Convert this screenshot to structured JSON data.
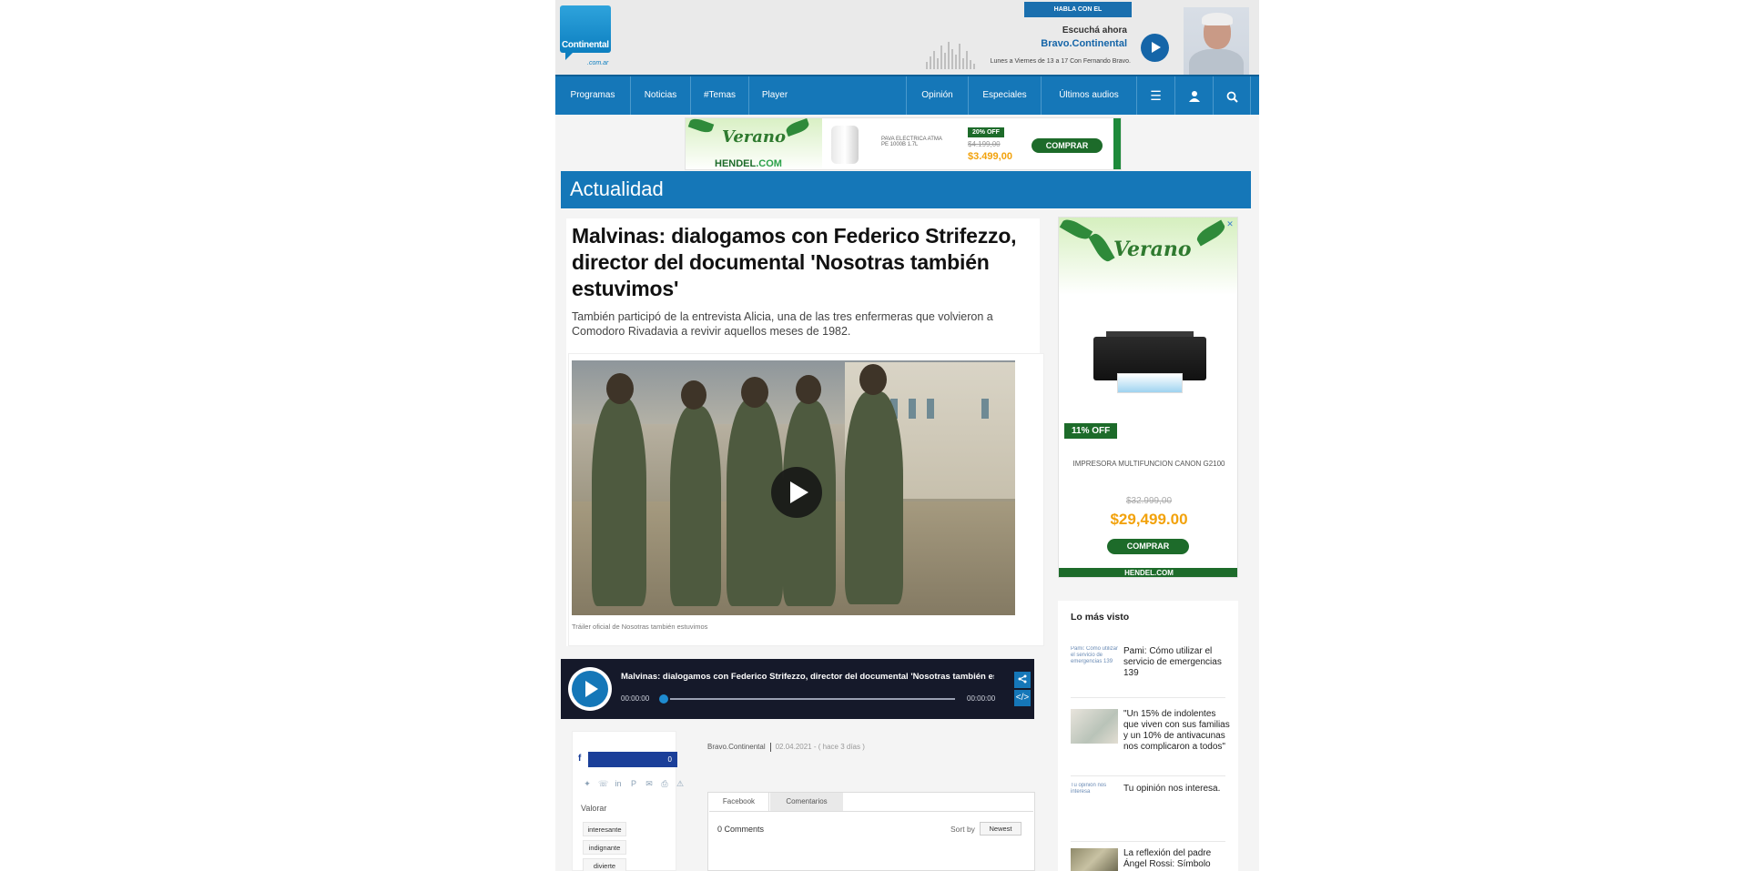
{
  "header": {
    "logo_name": "Continental",
    "logo_domain": ".com.ar",
    "habla_label": "HABLA CON EL",
    "listen_label": "Escuchá ahora",
    "show_name": "Bravo.Continental",
    "schedule": "Lunes a Viernes de 13 a 17 Con Fernando Bravo."
  },
  "nav": {
    "left": [
      "Programas",
      "Noticias",
      "#Temas",
      "Player"
    ],
    "right": [
      "Opinión",
      "Especiales",
      "Últimos audios"
    ],
    "icons": [
      "menu-icon",
      "user-icon",
      "search-icon"
    ]
  },
  "top_ad": {
    "brand_word": "Verano",
    "brand": "HENDEL",
    "brand_suffix": ".COM",
    "description": "PAVA ELECTRICA ATMA PE 1000B 1.7L",
    "discount": "20% OFF",
    "old_price": "$4.199,00",
    "price": "$3.499,00",
    "cta": "COMPRAR"
  },
  "section": {
    "title": "Actualidad"
  },
  "article": {
    "title": "Malvinas: dialogamos con Federico Strifezzo, director del documental 'Nosotras también estuvimos'",
    "subtitle": "También participó de la entrevista Alicia, una de las tres enfermeras que volvieron a Comodoro Rivadavia a revivir aquellos meses de 1982.",
    "video_caption": "Tráiler oficial de Nosotras también estuvimos",
    "author": "Bravo.Continental",
    "date": "02.04.2021 - ( hace 3 días )"
  },
  "audio_player": {
    "title": "Malvinas: dialogamos con Federico Strifezzo, director del documental 'Nosotras también estuvimos'",
    "current_time": "00:00:00",
    "duration": "00:00:00",
    "progress": 0
  },
  "social": {
    "fb_letter": "f",
    "fb_count": "0",
    "icons": [
      "twitter-icon",
      "whatsapp-icon",
      "linkedin-icon",
      "pinterest-icon",
      "email-icon",
      "print-icon",
      "warning-icon"
    ],
    "rate_label": "Valorar",
    "rate_options": [
      "interesante",
      "indignante",
      "divierte"
    ]
  },
  "comments": {
    "tabs": [
      "Facebook",
      "Comentarios"
    ],
    "count": "0 Comments",
    "sort_label": "Sort by",
    "sort_value": "Newest"
  },
  "side_ad": {
    "brand_word": "Verano",
    "discount": "11% OFF",
    "product": "IMPRESORA MULTIFUNCION CANON G2100",
    "old_price": "$32.999,00",
    "price": "$29,499.00",
    "cta": "COMPRAR",
    "brand": "HENDEL.COM"
  },
  "most_viewed": {
    "title": "Lo más visto",
    "items": [
      {
        "text": "Pami: Cómo utilizar el servicio de emergencias 139",
        "thumb_alt": "Pami: Cómo utilizar el servicio de emergencias 139"
      },
      {
        "text": "\"Un 15% de indolentes que viven con sus familias y un 10% de antivacunas nos complicaron a todos\"",
        "thumb_alt": ""
      },
      {
        "text": "Tu opinión nos interesa.",
        "thumb_alt": "Tu opinión nos interesa"
      },
      {
        "text": "La reflexión del padre Ángel Rossi: Símbolo",
        "thumb_alt": ""
      }
    ]
  }
}
